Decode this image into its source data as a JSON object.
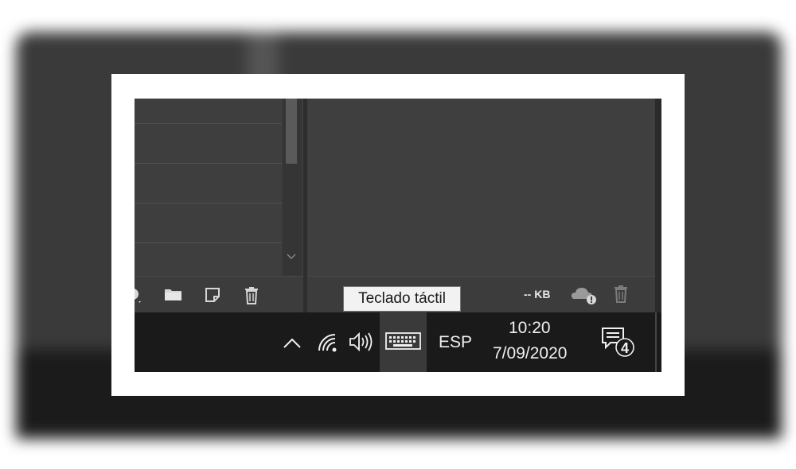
{
  "tooltip": {
    "text": "Teclado táctil"
  },
  "right_toolbar": {
    "size_label": "-- KB",
    "icons": [
      "cloud-warning-icon",
      "trash-icon"
    ]
  },
  "left_toolbar": {
    "icons": [
      "circle-dropdown-icon",
      "folder-icon",
      "new-note-icon",
      "trash-icon"
    ]
  },
  "taskbar": {
    "tray_icons": [
      "chevron-up-icon",
      "wifi-icon",
      "volume-icon",
      "keyboard-icon"
    ],
    "language": "ESP",
    "time": "10:20",
    "date": "7/09/2020",
    "notifications_count": "4"
  },
  "colors": {
    "taskbar": "#1a1a1a",
    "panel": "#3c3c3c",
    "tooltip_bg": "#f2f2f2"
  }
}
